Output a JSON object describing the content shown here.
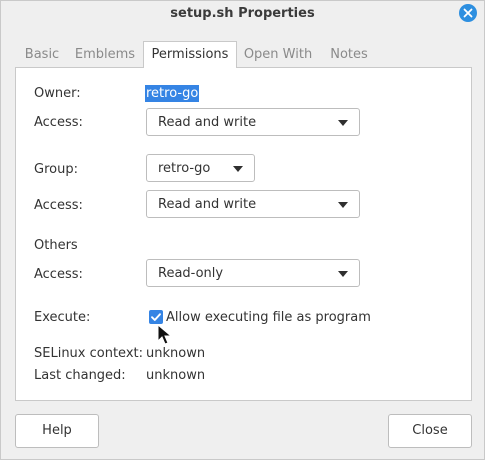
{
  "window": {
    "title": "setup.sh Properties"
  },
  "tabs": [
    {
      "label": "Basic",
      "active": false
    },
    {
      "label": "Emblems",
      "active": false
    },
    {
      "label": "Permissions",
      "active": true
    },
    {
      "label": "Open With",
      "active": false
    },
    {
      "label": "Notes",
      "active": false
    }
  ],
  "permissions": {
    "owner_label": "Owner:",
    "owner_value": "retro-go",
    "owner_access_label": "Access:",
    "owner_access_value": "Read and write",
    "group_label": "Group:",
    "group_value": "retro-go",
    "group_access_label": "Access:",
    "group_access_value": "Read and write",
    "others_heading": "Others",
    "others_access_label": "Access:",
    "others_access_value": "Read-only",
    "execute_label": "Execute:",
    "execute_checkbox_label": "Allow executing file as program",
    "execute_checked": true,
    "selinux_label": "SELinux context:",
    "selinux_value": "unknown",
    "last_changed_label": "Last changed:",
    "last_changed_value": "unknown"
  },
  "buttons": {
    "help": "Help",
    "close": "Close"
  },
  "colors": {
    "accent": "#3584e4",
    "close_button": "#2d8fe0",
    "window_bg": "#efefef",
    "panel_bg": "#ffffff"
  },
  "icons": {
    "close": "close-icon",
    "dropdown": "chevron-down-icon",
    "check": "checkmark-icon",
    "pointer": "mouse-pointer-icon"
  }
}
